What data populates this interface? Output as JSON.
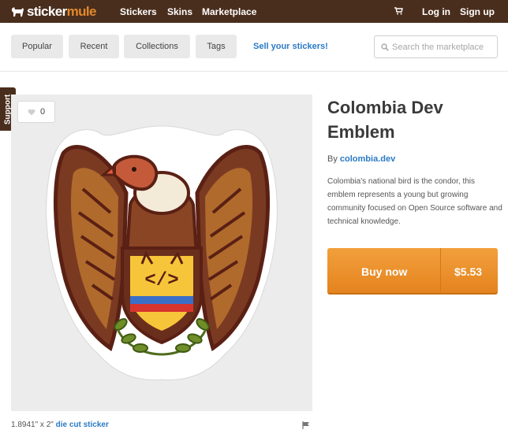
{
  "brand": {
    "part1": "sticker",
    "part2": "mule"
  },
  "nav": {
    "stickers": "Stickers",
    "skins": "Skins",
    "marketplace": "Marketplace",
    "login": "Log in",
    "signup": "Sign up"
  },
  "subnav": {
    "tabs": [
      "Popular",
      "Recent",
      "Collections",
      "Tags"
    ],
    "sell": "Sell your stickers!",
    "search_placeholder": "Search the marketplace"
  },
  "support_tab": "Support",
  "product": {
    "likes": "0",
    "title": "Colombia Dev Emblem",
    "by_prefix": "By ",
    "author": "colombia.dev",
    "description": "Colombia's national bird is the condor, this emblem represents a young but growing community focused on Open Source software and technical knowledge.",
    "buy_label": "Buy now",
    "price": "$5.53",
    "size": "1.8941\" x 2\"",
    "type": "die cut sticker",
    "code_symbol": "</>"
  },
  "icons": {
    "cart": "cart-icon",
    "search": "search-icon",
    "heart": "heart-icon",
    "flag": "flag-icon",
    "logo": "mule-logo-icon"
  },
  "colors": {
    "header_bg": "#4a2e1d",
    "brand_orange": "#e2892c",
    "link_blue": "#2a7ac6",
    "buy_orange": "#ee9531"
  }
}
